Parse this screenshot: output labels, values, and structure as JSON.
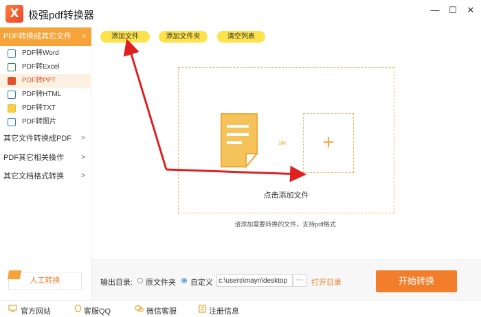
{
  "app": {
    "title": "极强pdf转换器",
    "logo_glyph": "X"
  },
  "window_controls": {
    "minimize": "—",
    "maximize": "☐",
    "close": "✕"
  },
  "sidebar": {
    "header": "PDF转换成其它文件",
    "header_chevron": "˅",
    "items": [
      {
        "label": "PDF转Word",
        "icon": "word-file-icon",
        "color": "#2b78d6"
      },
      {
        "label": "PDF转Excel",
        "icon": "excel-file-icon",
        "color": "#1e8b4a"
      },
      {
        "label": "PDF转PPT",
        "icon": "ppt-file-icon",
        "color": "#e0532e",
        "active": true
      },
      {
        "label": "PDF转HTML",
        "icon": "html-file-icon",
        "color": "#2b78d6"
      },
      {
        "label": "PDF转TXT",
        "icon": "txt-file-icon",
        "color": "#e9b420"
      },
      {
        "label": "PDF转图片",
        "icon": "image-file-icon",
        "color": "#2b78d6"
      }
    ],
    "groups": [
      {
        "label": "其它文件转换成PDF",
        "chevron": ">"
      },
      {
        "label": "PDF其它相关操作",
        "chevron": ">"
      },
      {
        "label": "其它文档格式转换",
        "chevron": ">"
      }
    ],
    "human_button": "人工转换"
  },
  "toolbar": {
    "add_file": "添加文件",
    "add_folder": "添加文件夹",
    "clear_list": "清空列表"
  },
  "dropzone": {
    "arrows": "»»",
    "plus": "+",
    "label": "点击添加文件"
  },
  "hint": "请添加需要转换的文件，支持pdf格式",
  "output": {
    "label": "输出目录:",
    "option_original": "原文件夹",
    "option_custom": "自定义",
    "selected": "custom",
    "path": "c:\\users\\mayn\\desktop",
    "browse": "···",
    "open_dir": "打开目录"
  },
  "start_button": "开始转换",
  "footer": {
    "website": "官方网站",
    "qq": "客服QQ",
    "wechat": "微信客服",
    "register": "注册信息"
  },
  "colors": {
    "accent_orange": "#f27e2c",
    "sidebar_header": "#f6a43a",
    "toolbar_yellow": "#fde24a",
    "annotation_red": "#e02020"
  }
}
